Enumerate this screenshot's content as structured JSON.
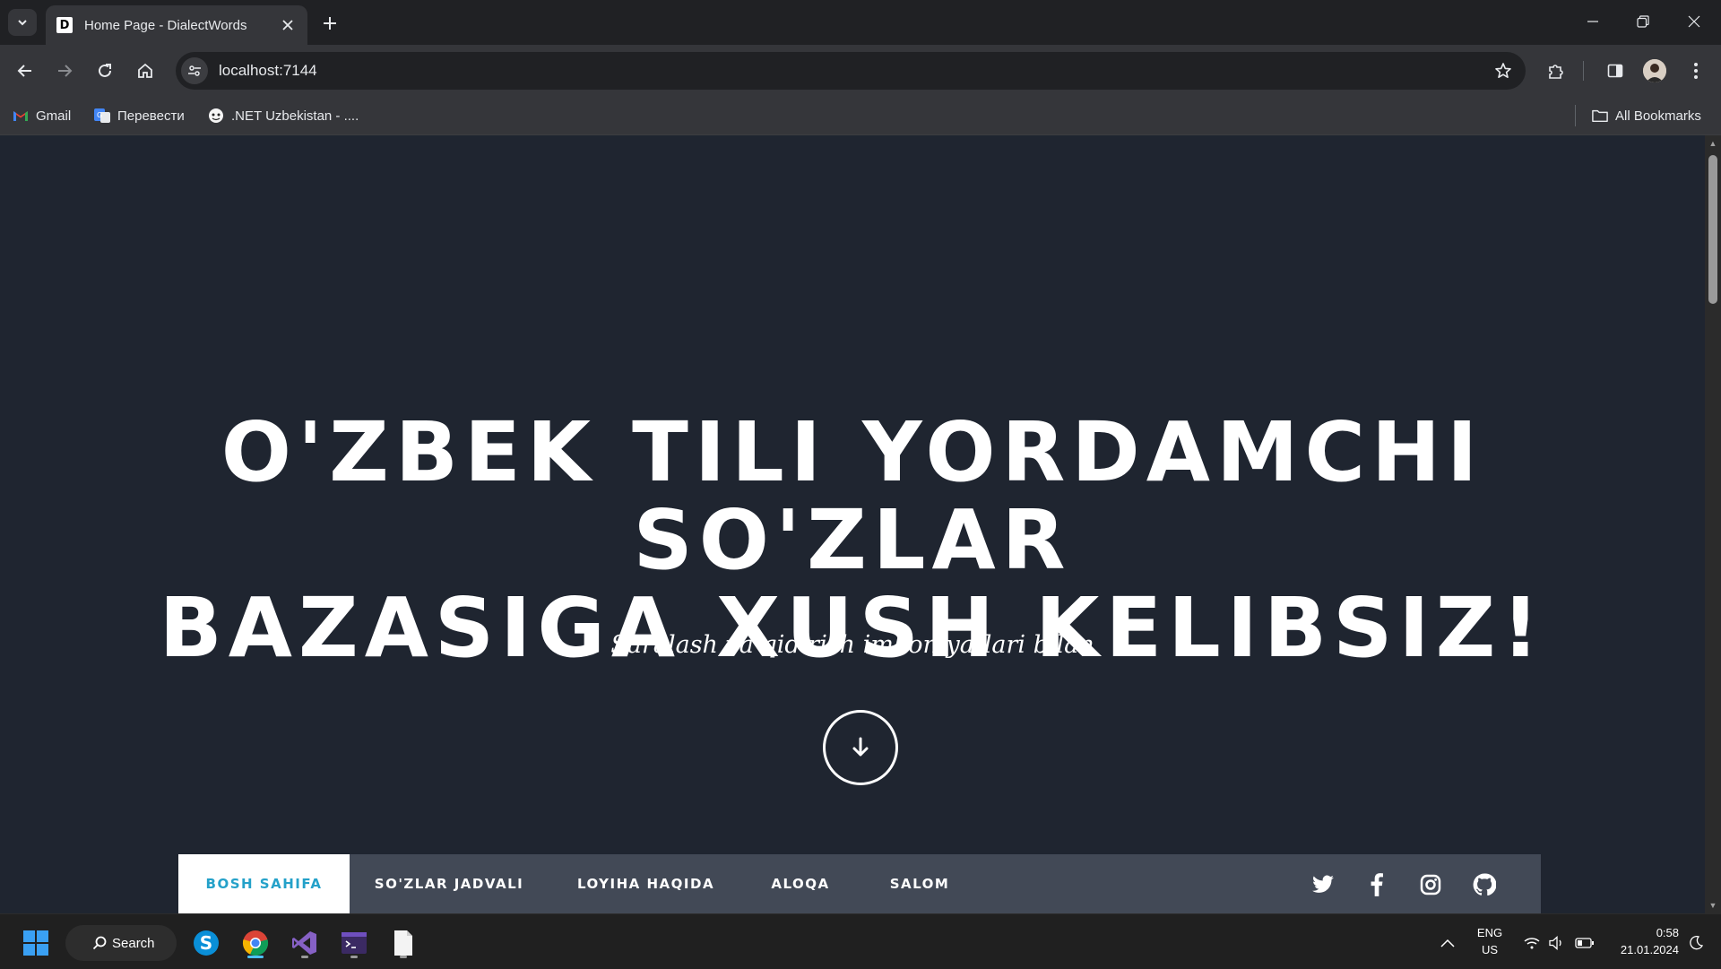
{
  "browser": {
    "tab_title": "Home Page - DialectWords",
    "favicon_letter": "D",
    "url": "localhost:7144",
    "bookmarks": [
      {
        "label": "Gmail",
        "icon": "gmail-icon"
      },
      {
        "label": "Перевести",
        "icon": "translate-icon"
      },
      {
        "label": ".NET Uzbekistan - ....",
        "icon": "dotnet-uz-icon"
      }
    ],
    "all_bookmarks_label": "All Bookmarks"
  },
  "hero": {
    "title_line1": "O'ZBEK TILI YORDAMCHI SO'ZLAR",
    "title_line2": "BAZASIGA XUSH KELIBSIZ!",
    "subtitle": "Saralash va qidirish imkoniyatlari bilan"
  },
  "nav": {
    "items": [
      {
        "label": "BOSH SAHIFA",
        "active": true
      },
      {
        "label": "SO'ZLAR JADVALI",
        "active": false
      },
      {
        "label": "LOYIHA HAQIDA",
        "active": false
      },
      {
        "label": "ALOQA",
        "active": false
      },
      {
        "label": "SALOM",
        "active": false
      }
    ],
    "social": [
      "twitter-icon",
      "facebook-icon",
      "instagram-icon",
      "github-icon"
    ],
    "active_color": "#24a1c9"
  },
  "taskbar": {
    "search_label": "Search",
    "apps": [
      "skype-icon",
      "chrome-icon",
      "visual-studio-icon",
      "terminal-icon",
      "notepad-icon"
    ],
    "lang_line1": "ENG",
    "lang_line2": "US",
    "time": "0:58",
    "date": "21.01.2024"
  },
  "colors": {
    "page_background": "#1f2530",
    "navbar_background": "#424956",
    "chrome_dark": "#202124",
    "chrome_toolbar": "#35363a"
  }
}
